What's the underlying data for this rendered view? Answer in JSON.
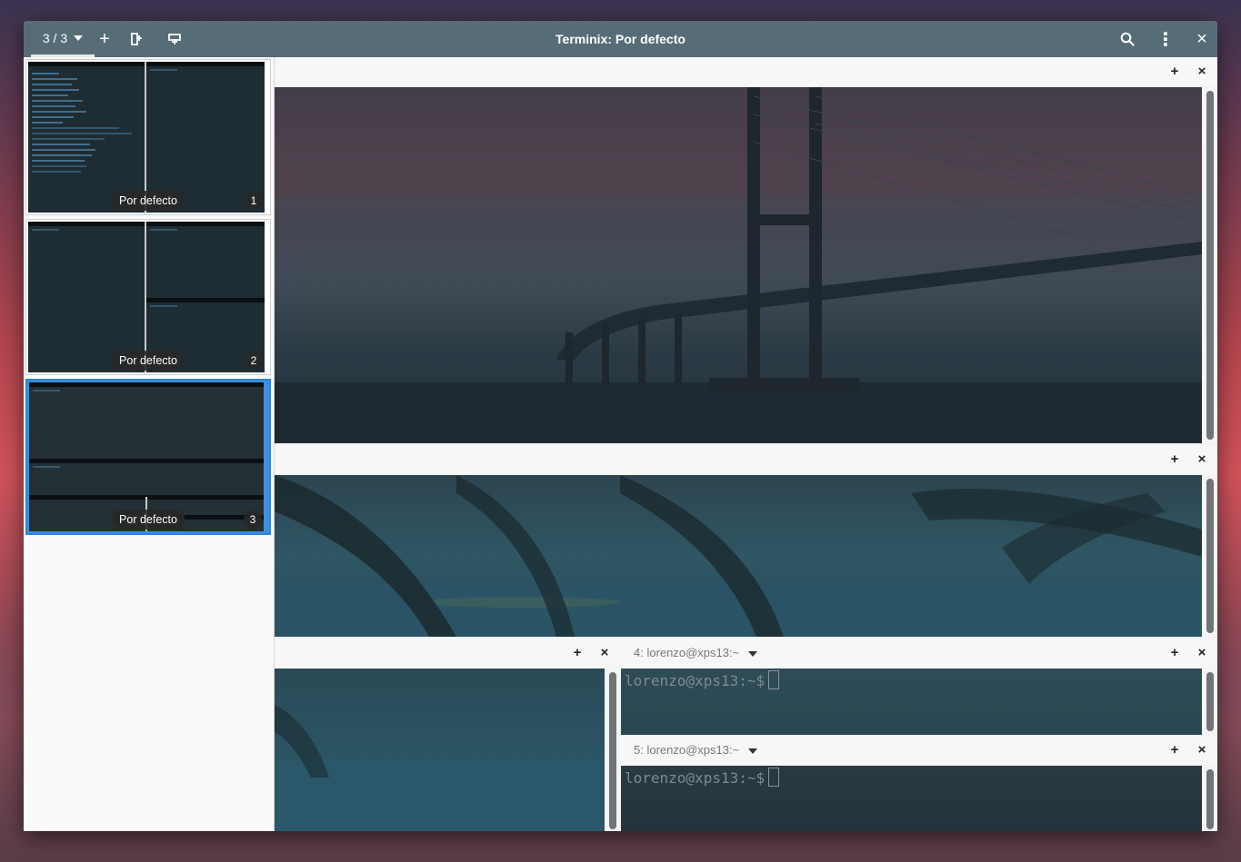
{
  "window": {
    "title": "Terminix: Por defecto",
    "session_counter": "3 / 3"
  },
  "icons": {
    "add": "+",
    "close": "×",
    "menu": "⋮"
  },
  "sidebar": {
    "sessions": [
      {
        "label": "Por defecto",
        "number": "1",
        "selected": false
      },
      {
        "label": "Por defecto",
        "number": "2",
        "selected": false
      },
      {
        "label": "Por defecto",
        "number": "3",
        "selected": true
      }
    ]
  },
  "panes": {
    "pane4": {
      "title": "4: lorenzo@xps13:~",
      "prompt": "lorenzo@xps13:~$"
    },
    "pane5": {
      "title": "5: lorenzo@xps13:~",
      "prompt": "lorenzo@xps13:~$"
    }
  },
  "colors": {
    "headerbar": "#566d78",
    "accent": "#2b86d8",
    "terminal_bg": "#1e2c33"
  }
}
